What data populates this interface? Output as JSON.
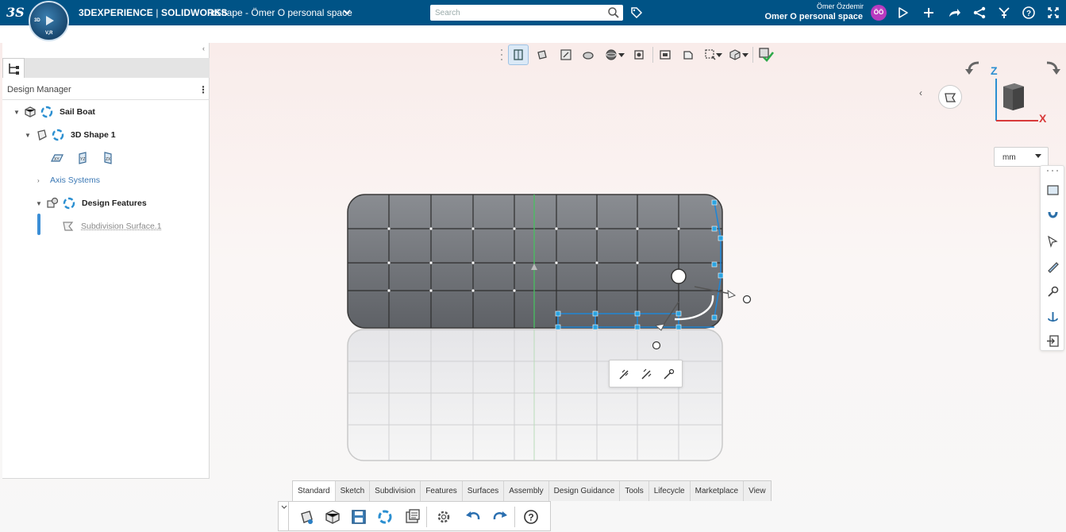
{
  "topbar": {
    "brand_bold": "3DEXPERIENCE",
    "brand_sep": " | ",
    "brand_light": "SOLIDWORKS",
    "app_title": "xShape - Ömer O personal space",
    "search_placeholder": "Search",
    "user_name": "Ömer Özdemir",
    "user_space": "Omer O personal space",
    "avatar_initials": "ÖÖ",
    "compass_labels": [
      "3D",
      "V,R"
    ]
  },
  "design_manager": {
    "title": "Design Manager",
    "more_label": "⋮",
    "tree": [
      {
        "label": "Sail Boat",
        "style": "bold"
      },
      {
        "label": "3D Shape 1",
        "style": "bold"
      },
      {
        "label": "Axis Systems",
        "style": "blue"
      },
      {
        "label": "Design Features",
        "style": "bold"
      },
      {
        "label": "Subdivision Surface.1",
        "style": "muted"
      }
    ]
  },
  "unit_select": {
    "value": "mm"
  },
  "viewcube": {
    "z_label": "Z",
    "x_label": "X"
  },
  "bottom_tabs": [
    "Standard",
    "Sketch",
    "Subdivision",
    "Features",
    "Surfaces",
    "Assembly",
    "Design Guidance",
    "Tools",
    "Lifecycle",
    "Marketplace",
    "View"
  ],
  "active_bottom_tab": "Standard",
  "colors": {
    "topbar": "#005386",
    "accent": "#3b8ed6",
    "handle_blue": "#2aa3e0",
    "avatar": "#b83ac0"
  }
}
